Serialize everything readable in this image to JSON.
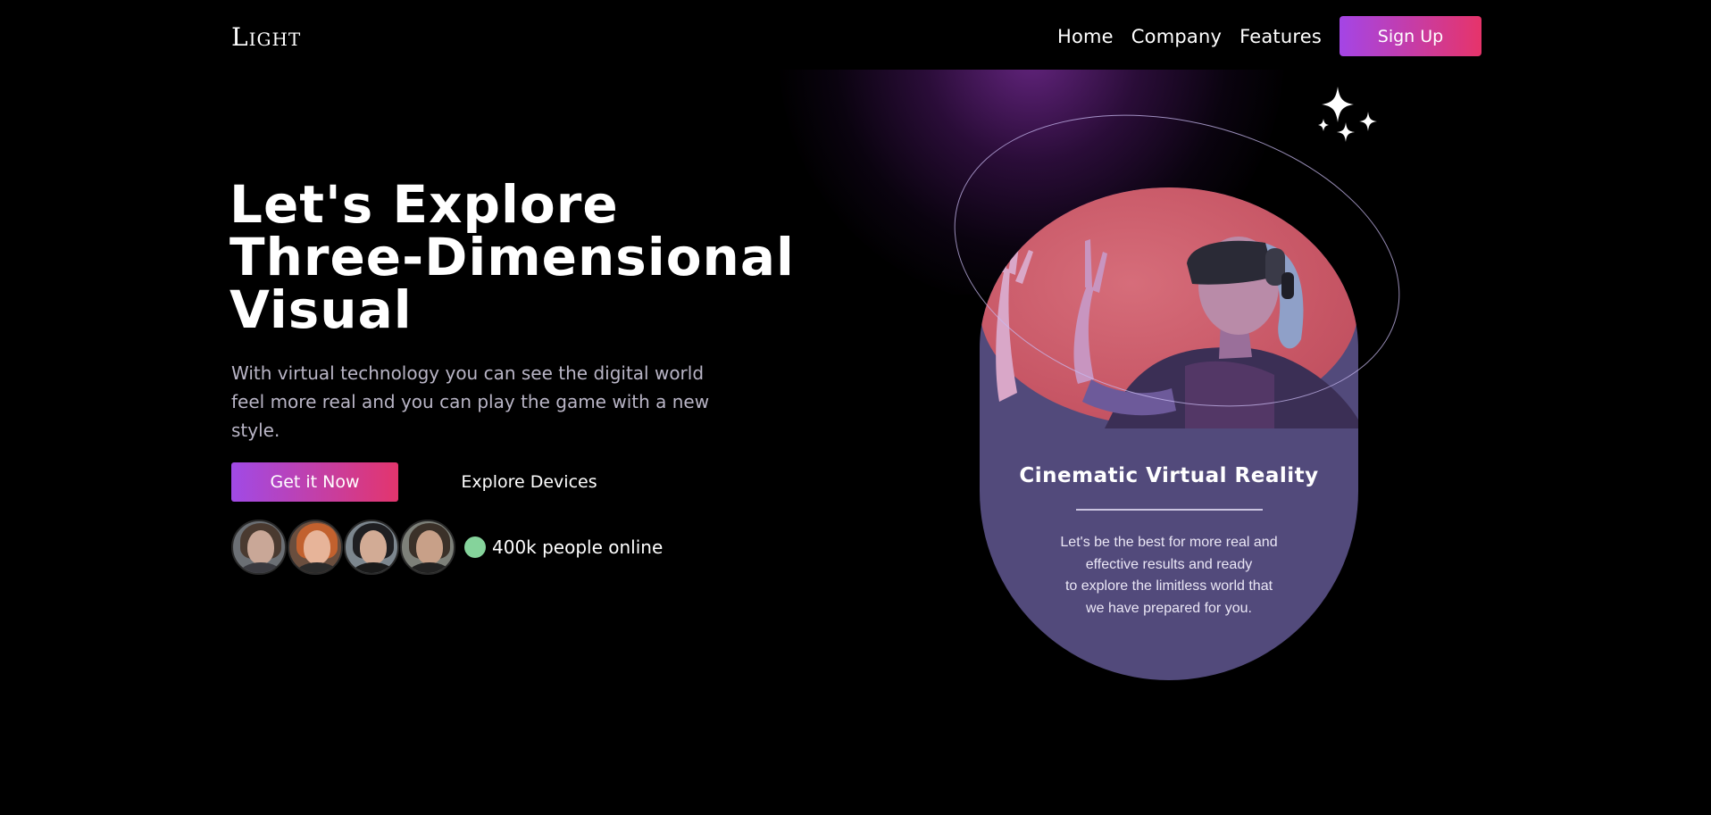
{
  "brand": {
    "logo": "Light"
  },
  "nav": {
    "items": [
      "Home",
      "Company",
      "Features"
    ],
    "signup_label": "Sign Up"
  },
  "hero": {
    "headline_lines": [
      "Let's Explore",
      "Three-Dimensional",
      "Visual"
    ],
    "subtext": "With virtual technology you can see the digital world feel more real and you can play the game with a new style.",
    "primary_cta": "Get it Now",
    "secondary_cta": "Explore Devices",
    "online_text": "400k people online"
  },
  "card": {
    "title": "Cinematic Virtual Reality",
    "body_lines": [
      "Let's be the best for more real and",
      "effective results and ready",
      "to explore the limitless world that",
      "we have prepared for you."
    ]
  },
  "colors": {
    "background": "#000000",
    "accent_gradient_start": "#a445e6",
    "accent_gradient_end": "#e6346a",
    "card": "#524a7b",
    "card_top": "#c75665",
    "online_dot": "#85d39b"
  },
  "icons": [
    "sparkles-icon"
  ]
}
